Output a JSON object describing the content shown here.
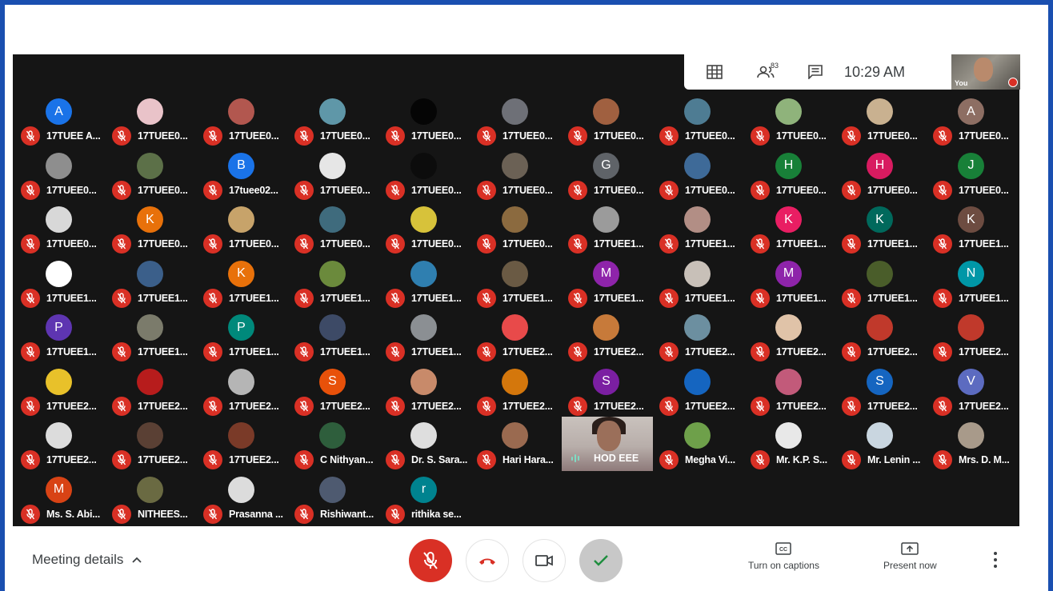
{
  "topbar": {
    "grid_icon": "grid-icon",
    "people_icon": "people-icon",
    "people_count": "83",
    "chat_icon": "chat-icon",
    "time": "10:29 AM",
    "self_label": "You"
  },
  "participants": [
    {
      "name": "17TUEE A...",
      "initial": "A",
      "color": "#1a73e8"
    },
    {
      "name": "17TUEE0...",
      "initial": "",
      "color": "#e9c3c9"
    },
    {
      "name": "17TUEE0...",
      "initial": "",
      "color": "#b2574f"
    },
    {
      "name": "17TUEE0...",
      "initial": "",
      "color": "#5f97a8"
    },
    {
      "name": "17TUEE0...",
      "initial": "",
      "color": "#050505"
    },
    {
      "name": "17TUEE0...",
      "initial": "",
      "color": "#6e7077"
    },
    {
      "name": "17TUEE0...",
      "initial": "",
      "color": "#a06040"
    },
    {
      "name": "17TUEE0...",
      "initial": "",
      "color": "#4e7c93"
    },
    {
      "name": "17TUEE0...",
      "initial": "",
      "color": "#8fb37b"
    },
    {
      "name": "17TUEE0...",
      "initial": "",
      "color": "#c9b190"
    },
    {
      "name": "17TUEE0...",
      "initial": "A",
      "color": "#8d6e63"
    },
    {
      "name": "17TUEE0...",
      "initial": "",
      "color": "#8e8e8e"
    },
    {
      "name": "17TUEE0...",
      "initial": "",
      "color": "#5c7048"
    },
    {
      "name": "17tuee02...",
      "initial": "B",
      "color": "#1a73e8"
    },
    {
      "name": "17TUEE0...",
      "initial": "",
      "color": "#e6e6e6"
    },
    {
      "name": "17TUEE0...",
      "initial": "",
      "color": "#0c0c0c"
    },
    {
      "name": "17TUEE0...",
      "initial": "",
      "color": "#6b6155"
    },
    {
      "name": "17TUEE0...",
      "initial": "G",
      "color": "#5f6368"
    },
    {
      "name": "17TUEE0...",
      "initial": "",
      "color": "#3e6a98"
    },
    {
      "name": "17TUEE0...",
      "initial": "H",
      "color": "#188038"
    },
    {
      "name": "17TUEE0...",
      "initial": "H",
      "color": "#d81b60"
    },
    {
      "name": "17TUEE0...",
      "initial": "J",
      "color": "#188038"
    },
    {
      "name": "17TUEE0...",
      "initial": "",
      "color": "#d8d8d8"
    },
    {
      "name": "17TUEE0...",
      "initial": "K",
      "color": "#e8710a"
    },
    {
      "name": "17TUEE0...",
      "initial": "",
      "color": "#c7a36a"
    },
    {
      "name": "17TUEE0...",
      "initial": "",
      "color": "#3f6b7d"
    },
    {
      "name": "17TUEE0...",
      "initial": "",
      "color": "#d7c23a"
    },
    {
      "name": "17TUEE0...",
      "initial": "",
      "color": "#8b6a3f"
    },
    {
      "name": "17TUEE1...",
      "initial": "",
      "color": "#9b9b9b"
    },
    {
      "name": "17TUEE1...",
      "initial": "",
      "color": "#b28e85"
    },
    {
      "name": "17TUEE1...",
      "initial": "K",
      "color": "#e91e63"
    },
    {
      "name": "17TUEE1...",
      "initial": "K",
      "color": "#00695c"
    },
    {
      "name": "17TUEE1...",
      "initial": "K",
      "color": "#6d4c41"
    },
    {
      "name": "17TUEE1...",
      "initial": "",
      "color": "#ffffff"
    },
    {
      "name": "17TUEE1...",
      "initial": "",
      "color": "#3b5f8a"
    },
    {
      "name": "17TUEE1...",
      "initial": "K",
      "color": "#e8710a"
    },
    {
      "name": "17TUEE1...",
      "initial": "",
      "color": "#6b8a3c"
    },
    {
      "name": "17TUEE1...",
      "initial": "",
      "color": "#2f7fb0"
    },
    {
      "name": "17TUEE1...",
      "initial": "",
      "color": "#6a5a44"
    },
    {
      "name": "17TUEE1...",
      "initial": "M",
      "color": "#8e24aa"
    },
    {
      "name": "17TUEE1...",
      "initial": "",
      "color": "#c8c0b8"
    },
    {
      "name": "17TUEE1...",
      "initial": "M",
      "color": "#8e24aa"
    },
    {
      "name": "17TUEE1...",
      "initial": "",
      "color": "#4a5d2a"
    },
    {
      "name": "17TUEE1...",
      "initial": "N",
      "color": "#0097a7"
    },
    {
      "name": "17TUEE1...",
      "initial": "P",
      "color": "#5e35b1"
    },
    {
      "name": "17TUEE1...",
      "initial": "",
      "color": "#7b7b6b"
    },
    {
      "name": "17TUEE1...",
      "initial": "P",
      "color": "#00897b"
    },
    {
      "name": "17TUEE1...",
      "initial": "",
      "color": "#3d4a66"
    },
    {
      "name": "17TUEE1...",
      "initial": "",
      "color": "#8b8f93"
    },
    {
      "name": "17TUEE2...",
      "initial": "",
      "color": "#e84a4a"
    },
    {
      "name": "17TUEE2...",
      "initial": "",
      "color": "#c77a3a"
    },
    {
      "name": "17TUEE2...",
      "initial": "",
      "color": "#6c8fa0"
    },
    {
      "name": "17TUEE2...",
      "initial": "",
      "color": "#e0c3a8"
    },
    {
      "name": "17TUEE2...",
      "initial": "",
      "color": "#c0392b"
    },
    {
      "name": "17TUEE2...",
      "initial": "",
      "color": "#c0392b"
    },
    {
      "name": "17TUEE2...",
      "initial": "",
      "color": "#e8c12a"
    },
    {
      "name": "17TUEE2...",
      "initial": "",
      "color": "#b71c1c"
    },
    {
      "name": "17TUEE2...",
      "initial": "",
      "color": "#b5b5b5"
    },
    {
      "name": "17TUEE2...",
      "initial": "S",
      "color": "#e8510a"
    },
    {
      "name": "17TUEE2...",
      "initial": "",
      "color": "#c88a6a"
    },
    {
      "name": "17TUEE2...",
      "initial": "",
      "color": "#d4770c"
    },
    {
      "name": "17TUEE2...",
      "initial": "S",
      "color": "#7b1fa2"
    },
    {
      "name": "17TUEE2...",
      "initial": "",
      "color": "#1565c0"
    },
    {
      "name": "17TUEE2...",
      "initial": "",
      "color": "#c25a7a"
    },
    {
      "name": "17TUEE2...",
      "initial": "S",
      "color": "#1565c0"
    },
    {
      "name": "17TUEE2...",
      "initial": "V",
      "color": "#5c6bc0"
    },
    {
      "name": "17TUEE2...",
      "initial": "",
      "color": "#dcdcdc"
    },
    {
      "name": "17TUEE2...",
      "initial": "",
      "color": "#5a4034"
    },
    {
      "name": "17TUEE2...",
      "initial": "",
      "color": "#7a3a28"
    },
    {
      "name": "C Nithyan...",
      "initial": "",
      "color": "#2e5e3c"
    },
    {
      "name": "Dr. S. Sara...",
      "initial": "",
      "color": "#dedede"
    },
    {
      "name": "Hari Hara...",
      "initial": "",
      "color": "#9a6a50"
    },
    null,
    {
      "name": "Megha Vi...",
      "initial": "",
      "color": "#6ea04a"
    },
    {
      "name": "Mr. K.P. S...",
      "initial": "",
      "color": "#e8e8e8"
    },
    {
      "name": "Mr. Lenin ...",
      "initial": "",
      "color": "#c9d6e0"
    },
    {
      "name": "Mrs. D. M...",
      "initial": "",
      "color": "#a89a8a"
    },
    {
      "name": "Ms. S. Abi...",
      "initial": "M",
      "color": "#d84315"
    },
    {
      "name": "NITHEES...",
      "initial": "",
      "color": "#6a6a42"
    },
    {
      "name": "Prasanna ...",
      "initial": "",
      "color": "#dcdcdc"
    },
    {
      "name": "Rishiwant...",
      "initial": "",
      "color": "#4e5a70"
    },
    {
      "name": "rithika se...",
      "initial": "r",
      "color": "#00838f"
    }
  ],
  "speaker": {
    "name": "HOD EEE"
  },
  "bottom": {
    "meeting_details": "Meeting details",
    "captions_label": "Turn on captions",
    "present_label": "Present now"
  },
  "colors": {
    "mute_red": "#d93025",
    "stage_bg": "#151515",
    "frame_blue": "#1a4fb0"
  }
}
